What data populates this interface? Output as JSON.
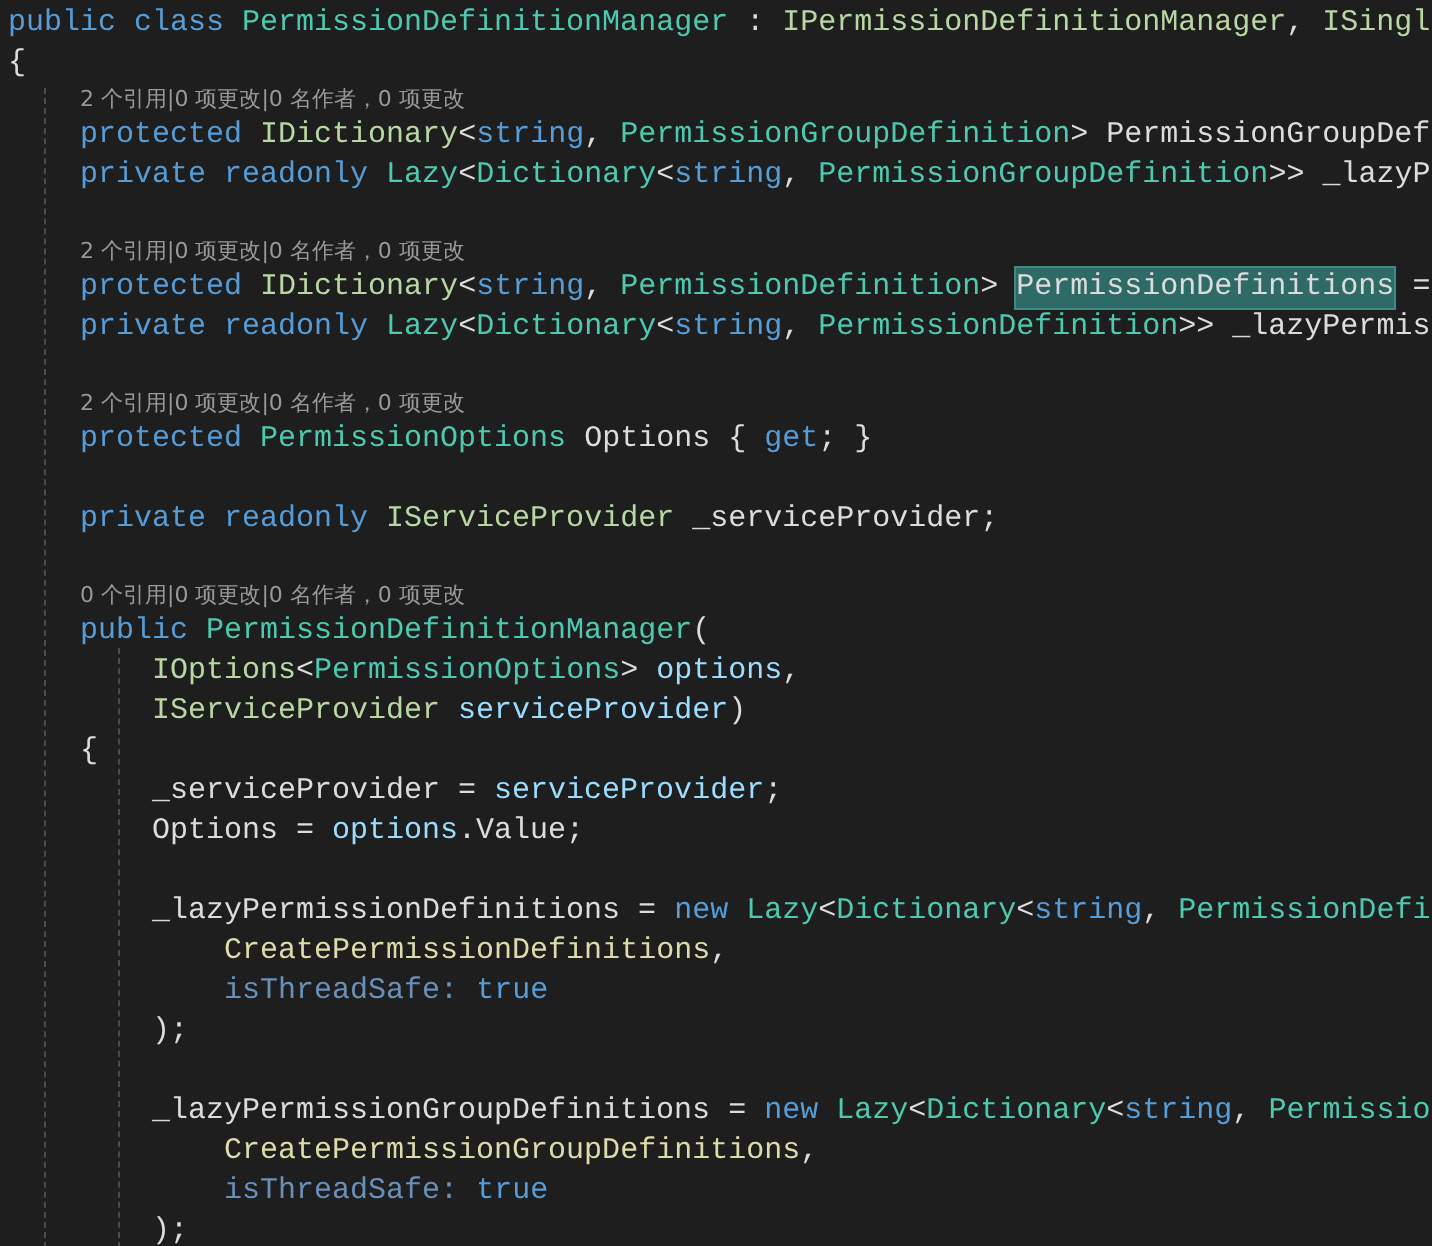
{
  "editor": {
    "lines": [
      {
        "kind": "code",
        "tokens": [
          {
            "kind": "keyword",
            "text": "public class "
          },
          {
            "kind": "class",
            "text": "PermissionDefinitionManager"
          },
          {
            "kind": "plain",
            "text": " : "
          },
          {
            "kind": "interface",
            "text": "IPermissionDefinitionManager"
          },
          {
            "kind": "plain",
            "text": ", "
          },
          {
            "kind": "interface",
            "text": "ISingl"
          }
        ]
      },
      {
        "kind": "code",
        "tokens": [
          {
            "kind": "plain",
            "text": "{"
          }
        ]
      },
      {
        "kind": "lens",
        "tokens": [
          {
            "kind": "lens",
            "text": "    2 个引用|0 项更改|0 名作者，0 项更改"
          }
        ]
      },
      {
        "kind": "code",
        "tokens": [
          {
            "kind": "keyword",
            "text": "    protected "
          },
          {
            "kind": "interface",
            "text": "IDictionary"
          },
          {
            "kind": "plain",
            "text": "<"
          },
          {
            "kind": "keyword",
            "text": "string"
          },
          {
            "kind": "plain",
            "text": ", "
          },
          {
            "kind": "class",
            "text": "PermissionGroupDefinition"
          },
          {
            "kind": "plain",
            "text": "> PermissionGroupDef"
          }
        ]
      },
      {
        "kind": "code",
        "tokens": [
          {
            "kind": "keyword",
            "text": "    private readonly "
          },
          {
            "kind": "class",
            "text": "Lazy"
          },
          {
            "kind": "plain",
            "text": "<"
          },
          {
            "kind": "class",
            "text": "Dictionary"
          },
          {
            "kind": "plain",
            "text": "<"
          },
          {
            "kind": "keyword",
            "text": "string"
          },
          {
            "kind": "plain",
            "text": ", "
          },
          {
            "kind": "class",
            "text": "PermissionGroupDefinition"
          },
          {
            "kind": "plain",
            "text": ">> _lazyP"
          }
        ]
      },
      {
        "kind": "blank"
      },
      {
        "kind": "lens",
        "tokens": [
          {
            "kind": "lens",
            "text": "    2 个引用|0 项更改|0 名作者，0 项更改"
          }
        ]
      },
      {
        "kind": "code",
        "tokens": [
          {
            "kind": "keyword",
            "text": "    protected "
          },
          {
            "kind": "interface",
            "text": "IDictionary"
          },
          {
            "kind": "plain",
            "text": "<"
          },
          {
            "kind": "keyword",
            "text": "string"
          },
          {
            "kind": "plain",
            "text": ", "
          },
          {
            "kind": "class",
            "text": "PermissionDefinition"
          },
          {
            "kind": "plain",
            "text": "> "
          },
          {
            "kind": "plain",
            "text": "PermissionDefinitions",
            "highlighted": true
          },
          {
            "kind": "plain",
            "text": " ="
          }
        ]
      },
      {
        "kind": "code",
        "tokens": [
          {
            "kind": "keyword",
            "text": "    private readonly "
          },
          {
            "kind": "class",
            "text": "Lazy"
          },
          {
            "kind": "plain",
            "text": "<"
          },
          {
            "kind": "class",
            "text": "Dictionary"
          },
          {
            "kind": "plain",
            "text": "<"
          },
          {
            "kind": "keyword",
            "text": "string"
          },
          {
            "kind": "plain",
            "text": ", "
          },
          {
            "kind": "class",
            "text": "PermissionDefinition"
          },
          {
            "kind": "plain",
            "text": ">> _lazyPermis"
          }
        ]
      },
      {
        "kind": "blank"
      },
      {
        "kind": "lens",
        "tokens": [
          {
            "kind": "lens",
            "text": "    2 个引用|0 项更改|0 名作者，0 项更改"
          }
        ]
      },
      {
        "kind": "code",
        "tokens": [
          {
            "kind": "keyword",
            "text": "    protected "
          },
          {
            "kind": "class",
            "text": "PermissionOptions"
          },
          {
            "kind": "plain",
            "text": " Options { "
          },
          {
            "kind": "keyword",
            "text": "get"
          },
          {
            "kind": "plain",
            "text": "; }"
          }
        ]
      },
      {
        "kind": "blank"
      },
      {
        "kind": "code",
        "tokens": [
          {
            "kind": "keyword",
            "text": "    private readonly "
          },
          {
            "kind": "interface",
            "text": "IServiceProvider"
          },
          {
            "kind": "plain",
            "text": " _serviceProvider;"
          }
        ]
      },
      {
        "kind": "blank"
      },
      {
        "kind": "lens",
        "tokens": [
          {
            "kind": "lens",
            "text": "    0 个引用|0 项更改|0 名作者，0 项更改"
          }
        ]
      },
      {
        "kind": "code",
        "tokens": [
          {
            "kind": "keyword",
            "text": "    public "
          },
          {
            "kind": "class",
            "text": "PermissionDefinitionManager"
          },
          {
            "kind": "plain",
            "text": "("
          }
        ]
      },
      {
        "kind": "code",
        "tokens": [
          {
            "kind": "interface",
            "text": "        IOptions"
          },
          {
            "kind": "plain",
            "text": "<"
          },
          {
            "kind": "class",
            "text": "PermissionOptions"
          },
          {
            "kind": "plain",
            "text": "> "
          },
          {
            "kind": "param",
            "text": "options"
          },
          {
            "kind": "plain",
            "text": ","
          }
        ]
      },
      {
        "kind": "code",
        "tokens": [
          {
            "kind": "interface",
            "text": "        IServiceProvider "
          },
          {
            "kind": "param",
            "text": "serviceProvider"
          },
          {
            "kind": "plain",
            "text": ")"
          }
        ]
      },
      {
        "kind": "code",
        "tokens": [
          {
            "kind": "plain",
            "text": "    {"
          }
        ]
      },
      {
        "kind": "code",
        "tokens": [
          {
            "kind": "plain",
            "text": "        _serviceProvider = "
          },
          {
            "kind": "param",
            "text": "serviceProvider"
          },
          {
            "kind": "plain",
            "text": ";"
          }
        ]
      },
      {
        "kind": "code",
        "tokens": [
          {
            "kind": "plain",
            "text": "        Options = "
          },
          {
            "kind": "param",
            "text": "options"
          },
          {
            "kind": "plain",
            "text": ".Value;"
          }
        ]
      },
      {
        "kind": "blank"
      },
      {
        "kind": "code",
        "tokens": [
          {
            "kind": "plain",
            "text": "        _lazyPermissionDefinitions = "
          },
          {
            "kind": "keyword",
            "text": "new "
          },
          {
            "kind": "class",
            "text": "Lazy"
          },
          {
            "kind": "plain",
            "text": "<"
          },
          {
            "kind": "class",
            "text": "Dictionary"
          },
          {
            "kind": "plain",
            "text": "<"
          },
          {
            "kind": "keyword",
            "text": "string"
          },
          {
            "kind": "plain",
            "text": ", "
          },
          {
            "kind": "class",
            "text": "PermissionDefi"
          }
        ]
      },
      {
        "kind": "code",
        "tokens": [
          {
            "kind": "method",
            "text": "            CreatePermissionDefinitions"
          },
          {
            "kind": "plain",
            "text": ","
          }
        ]
      },
      {
        "kind": "code",
        "tokens": [
          {
            "kind": "named",
            "text": "            isThreadSafe: "
          },
          {
            "kind": "keyword",
            "text": "true"
          }
        ]
      },
      {
        "kind": "code",
        "tokens": [
          {
            "kind": "plain",
            "text": "        );"
          }
        ]
      },
      {
        "kind": "blank"
      },
      {
        "kind": "code",
        "tokens": [
          {
            "kind": "plain",
            "text": "        _lazyPermissionGroupDefinitions = "
          },
          {
            "kind": "keyword",
            "text": "new "
          },
          {
            "kind": "class",
            "text": "Lazy"
          },
          {
            "kind": "plain",
            "text": "<"
          },
          {
            "kind": "class",
            "text": "Dictionary"
          },
          {
            "kind": "plain",
            "text": "<"
          },
          {
            "kind": "keyword",
            "text": "string"
          },
          {
            "kind": "plain",
            "text": ", "
          },
          {
            "kind": "class",
            "text": "Permissio"
          }
        ]
      },
      {
        "kind": "code",
        "tokens": [
          {
            "kind": "method",
            "text": "            CreatePermissionGroupDefinitions"
          },
          {
            "kind": "plain",
            "text": ","
          }
        ]
      },
      {
        "kind": "code",
        "tokens": [
          {
            "kind": "named",
            "text": "            isThreadSafe: "
          },
          {
            "kind": "keyword",
            "text": "true"
          }
        ]
      },
      {
        "kind": "code",
        "tokens": [
          {
            "kind": "plain",
            "text": "        );"
          }
        ]
      }
    ]
  }
}
